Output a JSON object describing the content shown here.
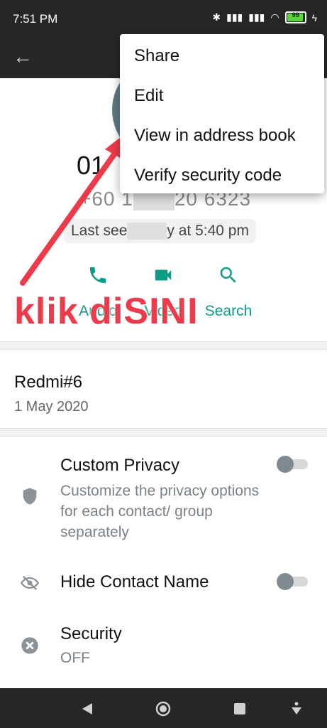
{
  "status": {
    "time": "7:51 PM",
    "battery": "99"
  },
  "contact": {
    "name": "01",
    "phone_parts": [
      "+60 1",
      "20 6323"
    ],
    "last_seen_parts": [
      "Last see",
      "y at 5:40 pm"
    ]
  },
  "actions": [
    {
      "label": "Audio",
      "icon": "phone-icon"
    },
    {
      "label": "Video",
      "icon": "video-icon"
    },
    {
      "label": "Search",
      "icon": "search-icon"
    }
  ],
  "annotation": {
    "text": "klik diSINI",
    "color": "#ee3b4b"
  },
  "device": {
    "title": "Redmi#6",
    "date": "1 May 2020"
  },
  "settings": [
    {
      "title": "Custom Privacy",
      "desc": "Customize the privacy options for each contact/ group separately",
      "icon": "shield-icon"
    },
    {
      "title": "Hide Contact Name",
      "icon": "eye-off-icon"
    },
    {
      "title": "Security",
      "value": "OFF",
      "icon": "x-circle-icon"
    }
  ],
  "menu": {
    "items": [
      "Share",
      "Edit",
      "View in address book",
      "Verify security code"
    ]
  },
  "colors": {
    "accent": "#0d9b88",
    "bar": "#262626"
  }
}
